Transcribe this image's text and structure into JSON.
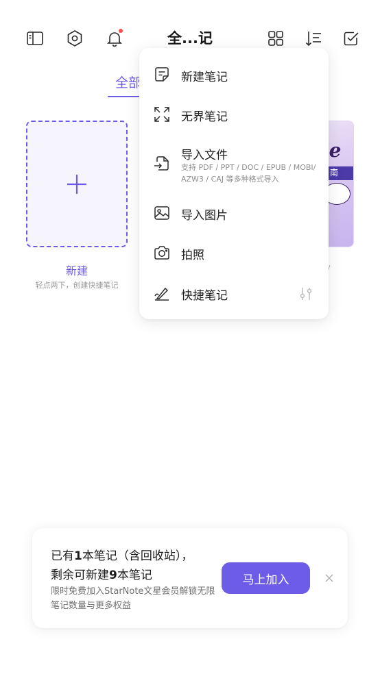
{
  "header": {
    "title": "全...记",
    "left_icons": [
      "sidebar-icon",
      "settings-icon",
      "bell-icon"
    ],
    "right_icons": [
      "grid-view-icon",
      "sort-icon",
      "select-check-icon"
    ],
    "notification_dot_color": "#ff4d4f"
  },
  "tabs": {
    "active_label": "全部"
  },
  "cards": {
    "new_label": "新建",
    "new_hint": "轻点两下，创建快捷笔记"
  },
  "menu": {
    "items": [
      {
        "label": "新建笔记",
        "icon": "note-edit-icon"
      },
      {
        "label": "无界笔记",
        "icon": "expand-canvas-icon"
      },
      {
        "label": "导入文件",
        "sub": "支持 PDF / PPT / DOC / EPUB / MOBI/ AZW3 / CAJ 等多种格式导入",
        "icon": "import-file-icon"
      },
      {
        "label": "导入图片",
        "icon": "image-icon"
      },
      {
        "label": "拍照",
        "icon": "camera-icon"
      },
      {
        "label": "快捷笔记",
        "icon": "quick-pen-icon",
        "trailing_icon": "adjust-sliders-icon"
      }
    ]
  },
  "banner": {
    "line1_pre": "已有",
    "line1_num": "1",
    "line1_post": "本笔记（含回收站），",
    "line2_pre": "剩余可新建",
    "line2_num": "9",
    "line2_post": "本笔记",
    "desc": "限时免费加入StarNote文星会员解锁无限笔记数量与更多权益",
    "button": "马上加入"
  },
  "colors": {
    "accent": "#6c5ce7",
    "text": "#1f1f1f",
    "muted": "#8e8e8e"
  }
}
